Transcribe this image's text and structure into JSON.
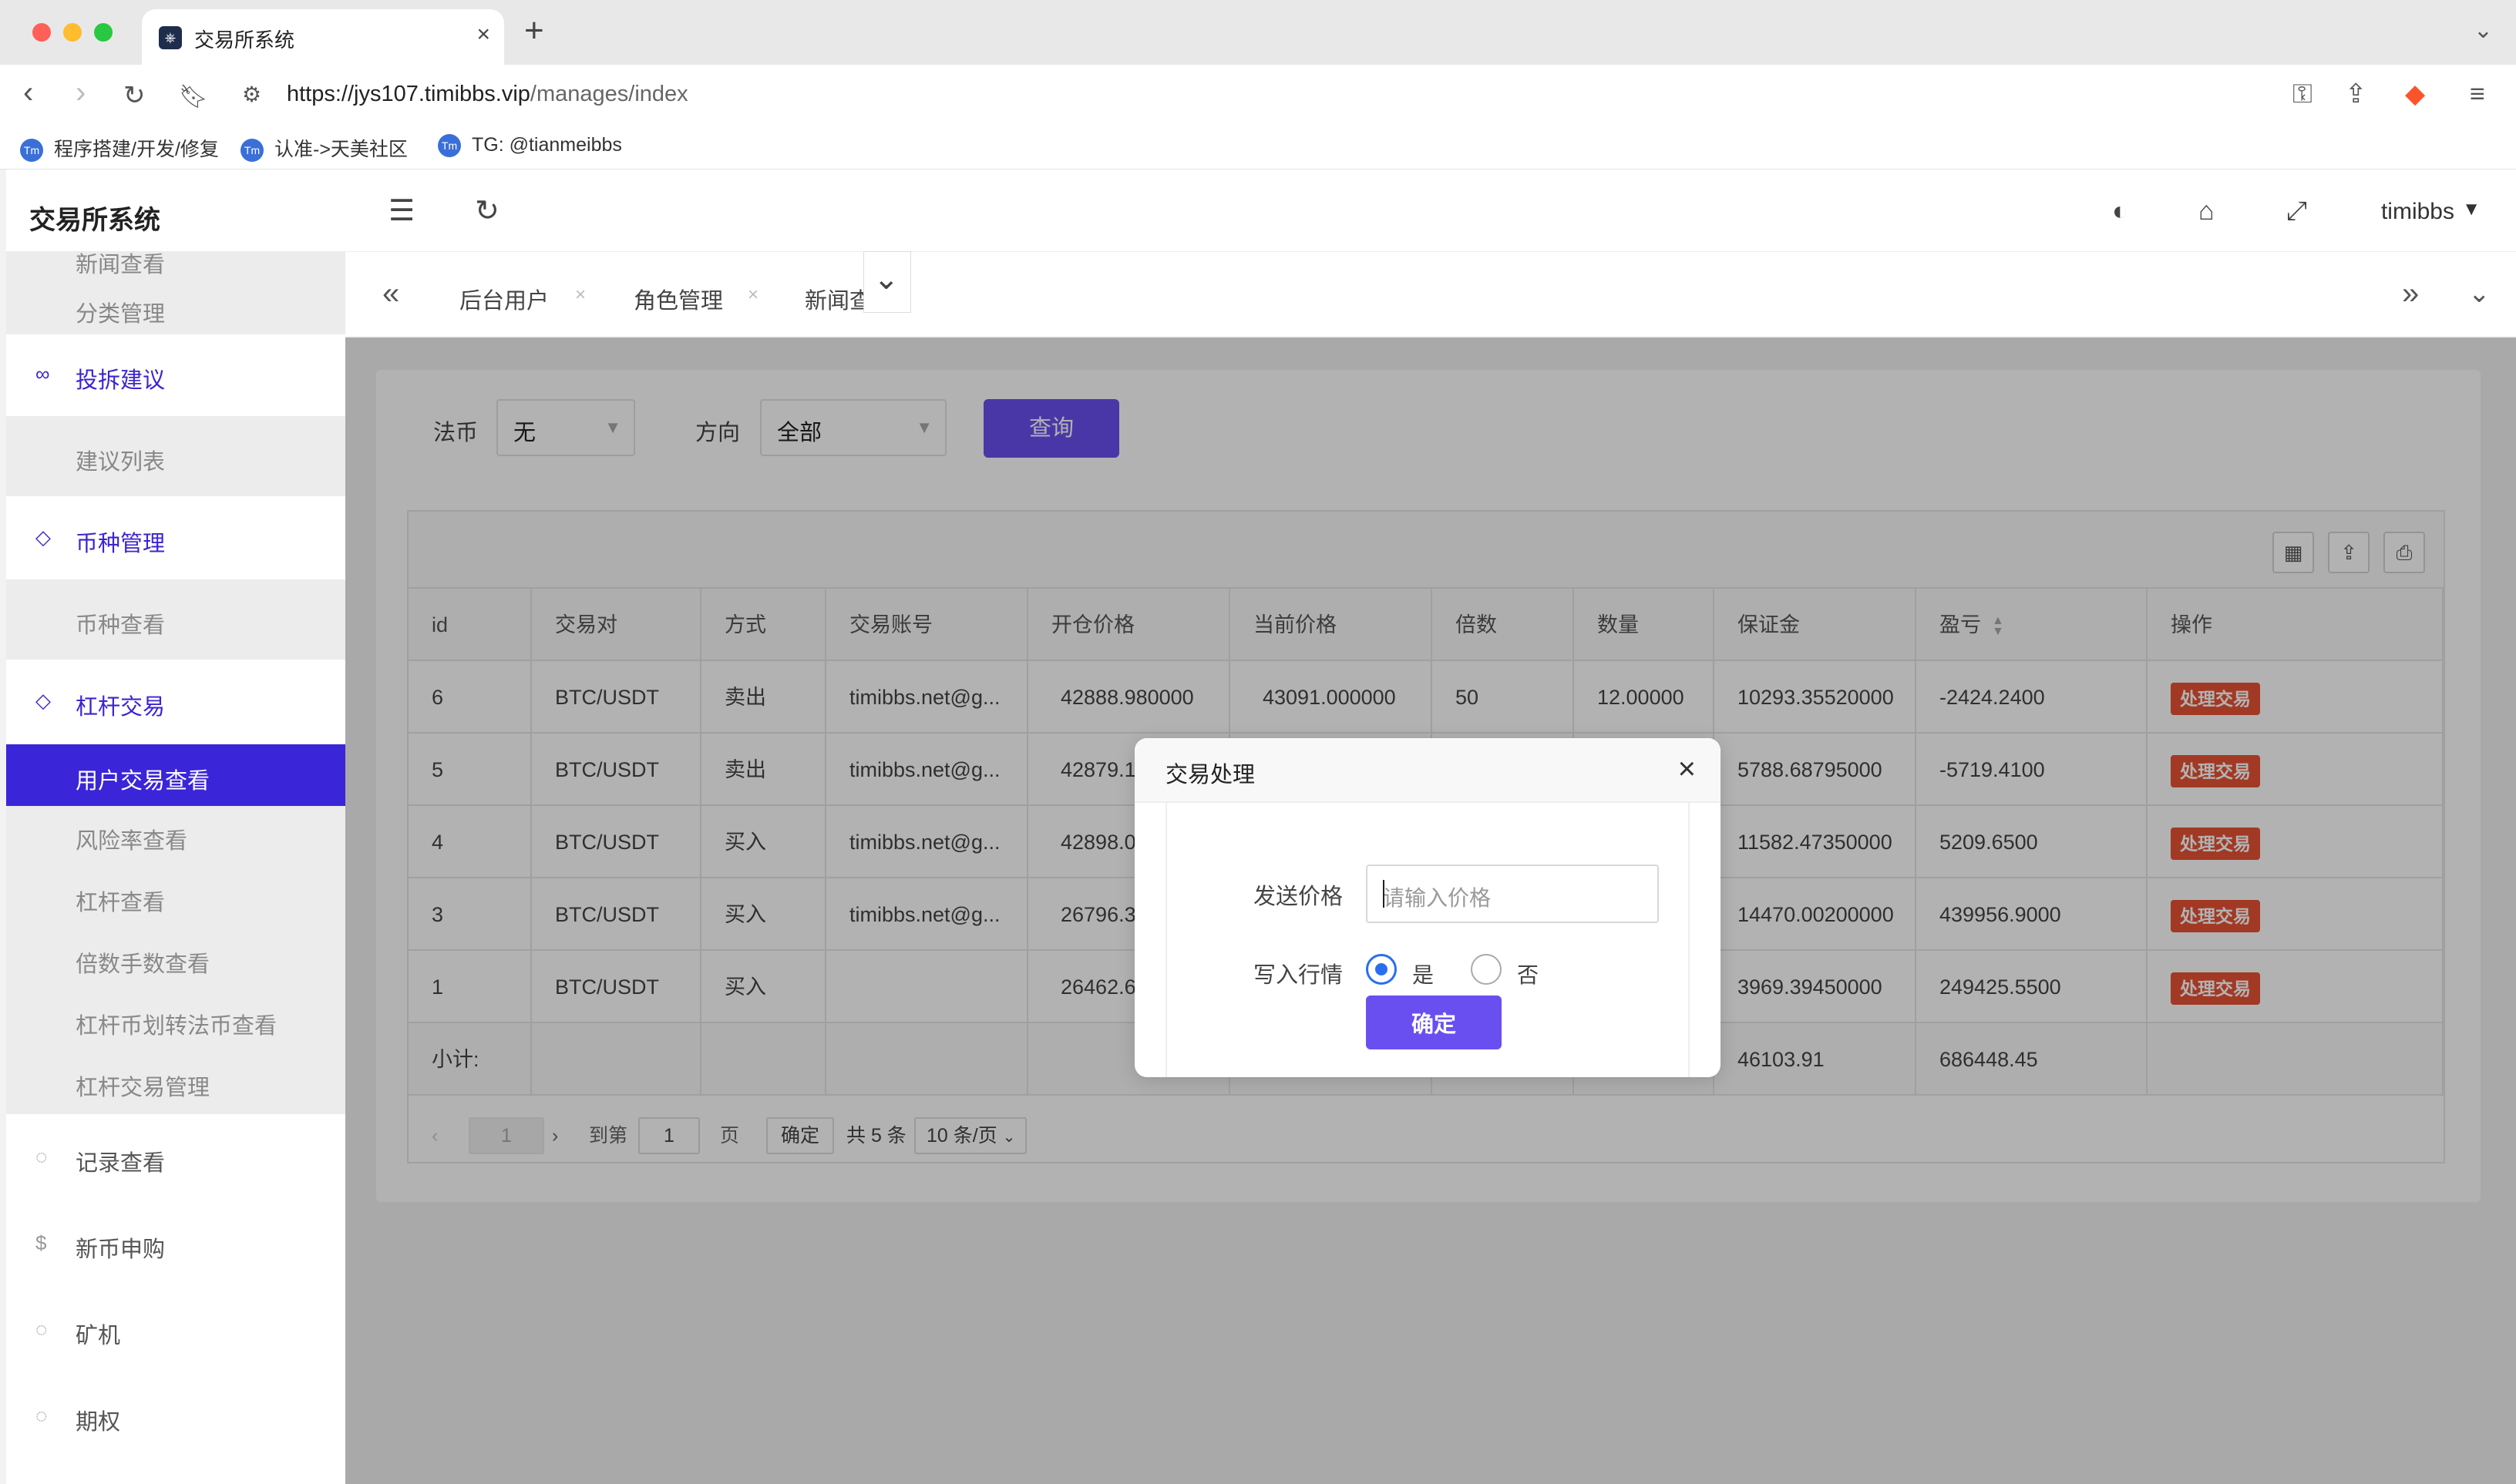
{
  "browser": {
    "tab_title": "交易所系统",
    "url_host": "https://jys107.timibbs.vip",
    "url_path": "/manages/index",
    "bookmarks": [
      "程序搭建/开发/修复",
      "认准->天美社区",
      "TG: @tianmeibbs"
    ]
  },
  "app": {
    "title": "交易所系统",
    "user": "timibbs"
  },
  "sidebar": {
    "items": [
      {
        "label": "新闻查看",
        "kind": "sub"
      },
      {
        "label": "分类管理",
        "kind": "sub"
      },
      {
        "label": "投拆建议",
        "kind": "group",
        "icon": "link-icon"
      },
      {
        "label": "建议列表",
        "kind": "sub"
      },
      {
        "label": "币种管理",
        "kind": "group",
        "icon": "diamond-icon"
      },
      {
        "label": "币种查看",
        "kind": "sub"
      },
      {
        "label": "杠杆交易",
        "kind": "group",
        "icon": "diamond-icon"
      },
      {
        "label": "用户交易查看",
        "kind": "active"
      },
      {
        "label": "风险率查看",
        "kind": "sub"
      },
      {
        "label": "杠杆查看",
        "kind": "sub"
      },
      {
        "label": "倍数手数查看",
        "kind": "sub"
      },
      {
        "label": "杠杆币划转法币查看",
        "kind": "sub"
      },
      {
        "label": "杠杆交易管理",
        "kind": "sub"
      },
      {
        "label": "记录查看",
        "kind": "plain",
        "icon": "circle-icon"
      },
      {
        "label": "新币申购",
        "kind": "plain",
        "icon": "dollar-icon"
      },
      {
        "label": "矿机",
        "kind": "plain",
        "icon": "circle-icon"
      },
      {
        "label": "期权",
        "kind": "plain",
        "icon": "circle-icon"
      }
    ]
  },
  "tabs": [
    "后台用户",
    "角色管理",
    "新闻查"
  ],
  "filters": {
    "fiat_label": "法币",
    "fiat_value": "无",
    "direction_label": "方向",
    "direction_value": "全部",
    "query_button": "查询"
  },
  "table": {
    "columns": [
      "id",
      "交易对",
      "方式",
      "交易账号",
      "开仓价格",
      "当前价格",
      "倍数",
      "数量",
      "保证金",
      "盈亏",
      "操作"
    ],
    "rows": [
      [
        "6",
        "BTC/USDT",
        "卖出",
        "timibbs.net@g...",
        "42888.980000",
        "43091.000000",
        "50",
        "12.00000",
        "10293.35520000",
        "-2424.2400",
        "处理交易"
      ],
      [
        "5",
        "BTC/USDT",
        "卖出",
        "timibbs.net@g...",
        "42879.1",
        "",
        "",
        "",
        "5788.68795000",
        "-5719.4100",
        "处理交易"
      ],
      [
        "4",
        "BTC/USDT",
        "买入",
        "timibbs.net@g...",
        "42898.0",
        "",
        "",
        "",
        "11582.47350000",
        "5209.6500",
        "处理交易"
      ],
      [
        "3",
        "BTC/USDT",
        "买入",
        "timibbs.net@g...",
        "26796.3",
        "",
        "",
        "",
        "14470.00200000",
        "439956.9000",
        "处理交易"
      ],
      [
        "1",
        "BTC/USDT",
        "买入",
        "",
        "26462.6",
        "",
        "",
        "",
        "3969.39450000",
        "249425.5500",
        "处理交易"
      ]
    ],
    "summary": {
      "label": "小计:",
      "margin": "46103.91",
      "pnl": "686448.45"
    }
  },
  "pager": {
    "page": "1",
    "goto_label": "到第",
    "goto_value": "1",
    "page_suffix": "页",
    "confirm": "确定",
    "total": "共 5 条",
    "page_size": "10 条/页"
  },
  "modal": {
    "title": "交易处理",
    "price_label": "发送价格",
    "price_placeholder": "请输入价格",
    "market_label": "写入行情",
    "opt_yes": "是",
    "opt_no": "否",
    "selected": "是",
    "confirm": "确定"
  }
}
